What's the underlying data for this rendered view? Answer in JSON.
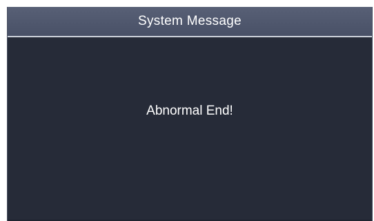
{
  "dialog": {
    "title": "System Message",
    "message": "Abnormal End!"
  },
  "colors": {
    "titlebar": "#4f576d",
    "body": "#262b38",
    "text": "#ffffff"
  }
}
